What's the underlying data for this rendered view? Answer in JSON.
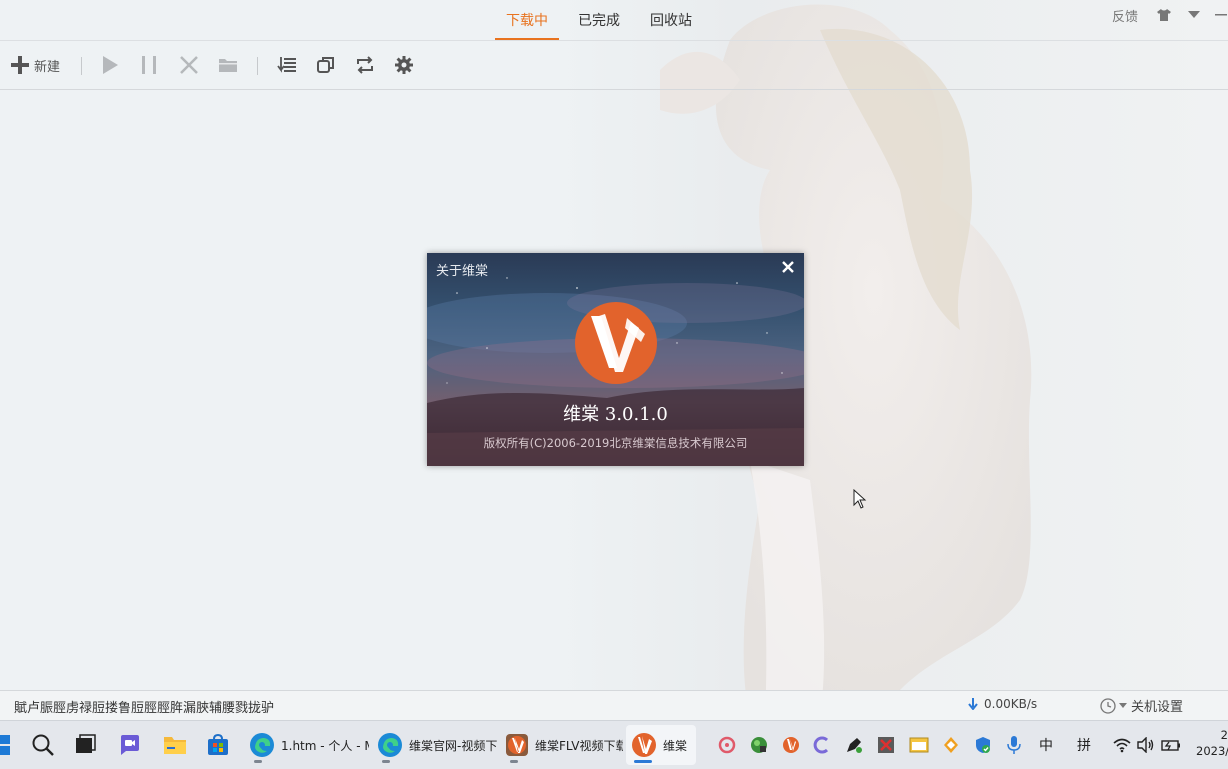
{
  "topbar": {
    "tabs": [
      {
        "label": "下载中",
        "active": true
      },
      {
        "label": "已完成",
        "active": false
      },
      {
        "label": "回收站",
        "active": false
      }
    ],
    "feedback_label": "反馈",
    "icons": [
      "skin-icon",
      "dropdown-arrow-icon",
      "minimize-icon"
    ]
  },
  "toolbar": {
    "new_label": "新建",
    "icons": [
      "plus-icon",
      "play-icon",
      "pause-icon",
      "delete-icon",
      "folder-icon",
      "list-sort-icon",
      "window-copy-icon",
      "refresh-icon",
      "gear-icon"
    ]
  },
  "dialog": {
    "title": "关于维棠",
    "version": "维棠 3.0.1.0",
    "copyright": "版权所有(C)2006-2019北京维棠信息技术有限公司"
  },
  "statusbar": {
    "message": "賦卢脤脛虏禄脰搂鲁脰脛脛脌漏脥辅腰戮拢驴",
    "speed": "0.00KB/s",
    "shutdown_label": "关机设置"
  },
  "taskbar": {
    "apps": [
      {
        "label": "1.htm - 个人 - M",
        "icon": "edge-icon"
      },
      {
        "label": "维棠官网-视频下",
        "icon": "edge-icon"
      },
      {
        "label": "维棠FLV视频下载",
        "icon": "vidown-icon"
      },
      {
        "label": "维棠",
        "icon": "vidown-icon",
        "active": true
      }
    ],
    "ime_lang": "中",
    "ime_mode": "拼",
    "clock_time": "2",
    "clock_date": "2023/"
  },
  "colors": {
    "accent": "#e8731f",
    "taskbar_active": "#2b79d6"
  }
}
